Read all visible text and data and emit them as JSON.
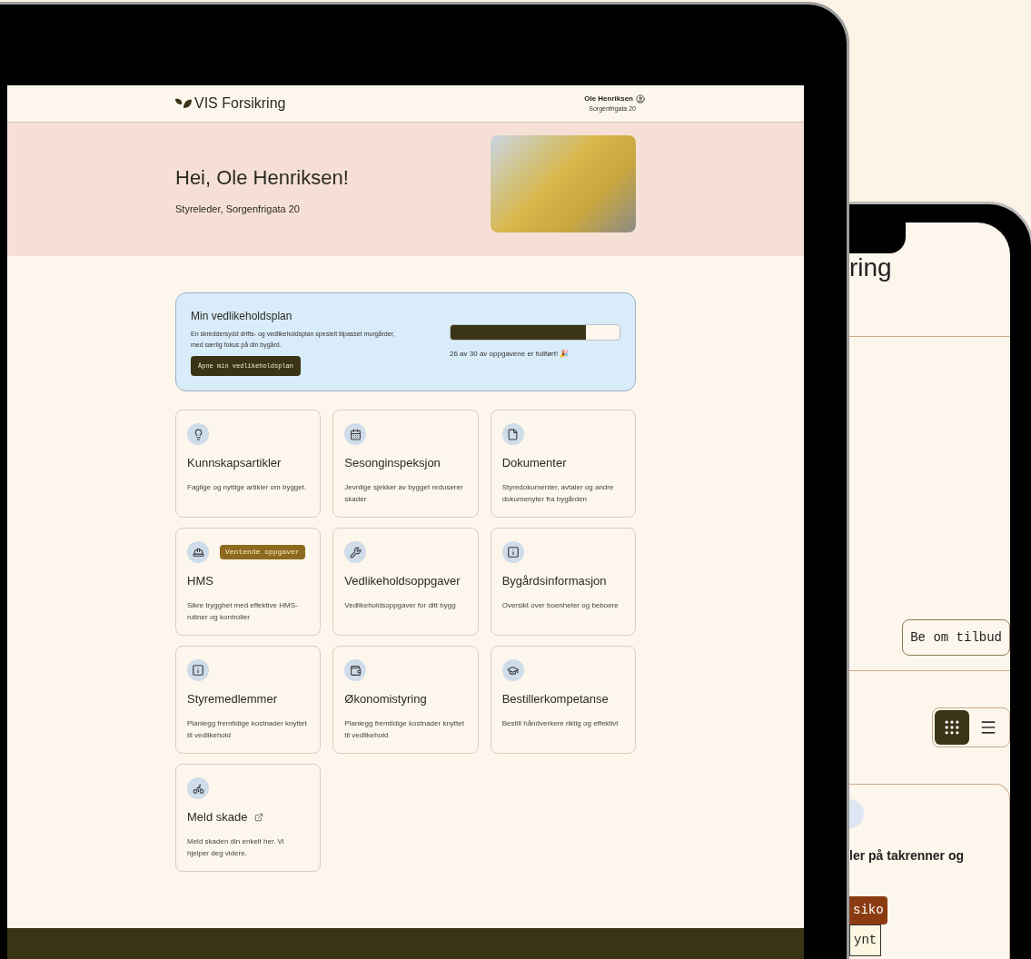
{
  "tablet": {
    "header": {
      "logo": "VIS Forsikring",
      "user_name": "Ole Henriksen",
      "user_address": "Sorgenfrigata 20"
    },
    "hero": {
      "greeting": "Hei, Ole Henriksen!",
      "subtitle": "Styreleder, Sorgenfrigata 20"
    },
    "plan": {
      "title": "Min vedlikeholdsplan",
      "description": "En skreddersydd drifts- og vedlikeholdsplan spesielt tilpasset murgårder, med særlig fokus på din bygård.",
      "button": "Åpne min vedlikeholdsplan",
      "level": 0.8,
      "progress_text": "26 av 30 av oppgavene er fullført! 🎉"
    },
    "cards": [
      {
        "title": "Kunnskapsartikler",
        "description": "Faglige og nyttige artikler om bygget."
      },
      {
        "title": "Sesonginspeksjon",
        "description": "Jevnlige sjekker av bygget reduserer skader"
      },
      {
        "title": "Dokumenter",
        "description": "Styredokumenter, avtaler og andre dokumenyter fra bygården"
      },
      {
        "title": "HMS",
        "description": "Sikre trygghet med effektive HMS-rutiner og kontroller",
        "badge": "Ventende oppgaver"
      },
      {
        "title": "Vedlikeholdsoppgaver",
        "description": "Vedlikeholdsoppgaver for ditt bygg"
      },
      {
        "title": "Bygårdsinformasjon",
        "description": "Oversikt over boenheter og beboere"
      },
      {
        "title": "Styremedlemmer",
        "description": "Planlegg fremtidige kostnader knyttet til vedlikehold"
      },
      {
        "title": "Økonomistyring",
        "description": "Planlegg fremtidige kostnader knyttet til vedlikehold"
      },
      {
        "title": "Bestillerkompetanse",
        "description": "Bestill håndverkere riktig og effektivt"
      },
      {
        "title": "Meld skade",
        "description": "Meld skaden din enkelt her. Vi hjelper deg videre.",
        "external": true
      }
    ]
  },
  "phone": {
    "logo_fragment": "ring",
    "button": "Be om tilbud",
    "view_toggle": [
      {
        "kind": "grid",
        "selected": true
      },
      {
        "kind": "list",
        "selected": false
      }
    ],
    "card": {
      "title_fragment": "ler på takrenner og",
      "tag": "siko",
      "button": "ynt"
    }
  }
}
